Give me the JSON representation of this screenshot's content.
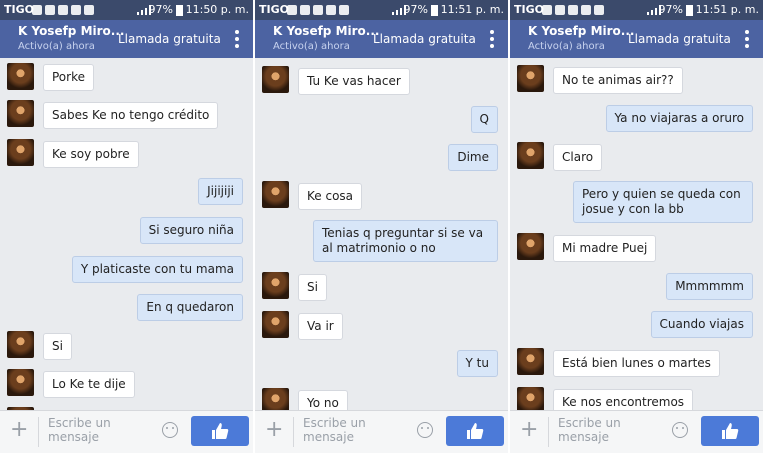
{
  "panels": [
    {
      "status": {
        "carrier": "TIGO",
        "battery": "97%",
        "time": "11:50 p. m."
      },
      "header": {
        "name": "K Yosefp Miro...",
        "subtitle": "Activo(a) ahora",
        "call": "Llamada gratuita"
      },
      "composer": {
        "placeholder": "Escribe un mensaje"
      },
      "messages": [
        {
          "dir": "in",
          "text": "Porke"
        },
        {
          "dir": "in",
          "text": "Sabes Ke no tengo crédito"
        },
        {
          "dir": "in",
          "text": "Ke soy pobre"
        },
        {
          "dir": "out",
          "text": "Jijijiji"
        },
        {
          "dir": "out",
          "text": "Si seguro niña"
        },
        {
          "dir": "out",
          "text": "Y platicaste con tu mama"
        },
        {
          "dir": "out",
          "text": "En q quedaron"
        },
        {
          "dir": "in",
          "text": "Si"
        },
        {
          "dir": "in",
          "text": "Lo Ke te dije"
        }
      ]
    },
    {
      "status": {
        "carrier": "TIGO",
        "battery": "97%",
        "time": "11:51 p. m."
      },
      "header": {
        "name": "K Yosefp Miro...",
        "subtitle": "Activo(a) ahora",
        "call": "Llamada gratuita"
      },
      "composer": {
        "placeholder": "Escribe un mensaje"
      },
      "messages": [
        {
          "dir": "in",
          "text": "Tu Ke vas hacer"
        },
        {
          "dir": "out",
          "text": "Q"
        },
        {
          "dir": "out",
          "text": "Dime"
        },
        {
          "dir": "in",
          "text": "Ke cosa"
        },
        {
          "dir": "out",
          "text": "Tenias q preguntar si se va al matrimonio o no"
        },
        {
          "dir": "in",
          "text": "Si"
        },
        {
          "dir": "in",
          "text": "Va ir"
        },
        {
          "dir": "out",
          "text": "Y tu"
        },
        {
          "dir": "in",
          "text": "Yo no"
        }
      ]
    },
    {
      "status": {
        "carrier": "TIGO",
        "battery": "97%",
        "time": "11:51 p. m."
      },
      "header": {
        "name": "K Yosefp Miro...",
        "subtitle": "Activo(a) ahora",
        "call": "Llamada gratuita"
      },
      "composer": {
        "placeholder": "Escribe un mensaje"
      },
      "messages": [
        {
          "dir": "in",
          "text": "No te animas air??"
        },
        {
          "dir": "out",
          "text": "Ya no viajaras a oruro"
        },
        {
          "dir": "in",
          "text": "Claro"
        },
        {
          "dir": "out",
          "text": "Pero y quien se queda con josue y con la bb"
        },
        {
          "dir": "in",
          "text": "Mi madre Puej"
        },
        {
          "dir": "out",
          "text": "Mmmmmm"
        },
        {
          "dir": "out",
          "text": "Cuando viajas"
        },
        {
          "dir": "in",
          "text": "Está bien lunes o martes"
        },
        {
          "dir": "in",
          "text": "Ke nos encontremos"
        }
      ]
    }
  ]
}
